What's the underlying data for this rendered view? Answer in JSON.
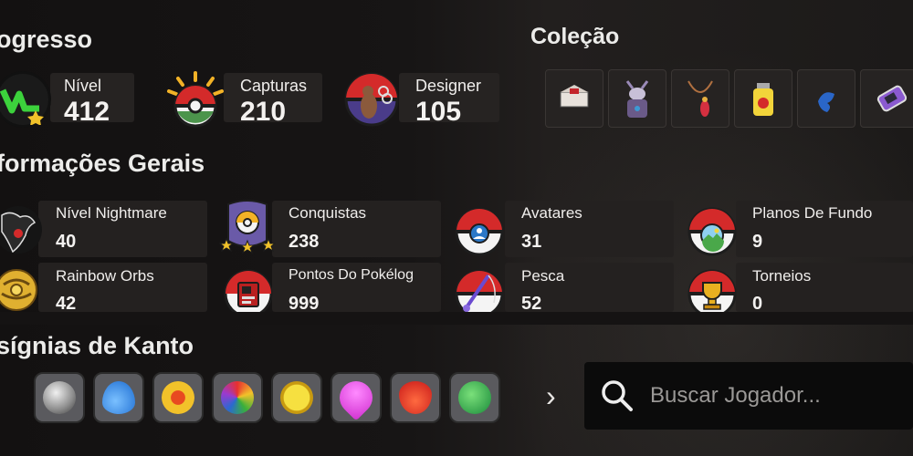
{
  "sections": {
    "progress_title": "ogresso",
    "collection_title": "Coleção",
    "general_title": "formações Gerais",
    "badges_title": "sígnias de Kanto"
  },
  "progress": [
    {
      "label": "Nível",
      "value": "412",
      "icon": "level-icon"
    },
    {
      "label": "Capturas",
      "value": "210",
      "icon": "pokeball-sun-icon"
    },
    {
      "label": "Designer",
      "value": "105",
      "icon": "designer-scissors-icon"
    }
  ],
  "general": [
    {
      "label": "Nível Nightmare",
      "value": "40",
      "icon": "darkrai-icon"
    },
    {
      "label": "Conquistas",
      "value": "238",
      "icon": "stars-pokeball-icon"
    },
    {
      "label": "Avatares",
      "value": "31",
      "icon": "avatar-pokeball-icon"
    },
    {
      "label": "Planos De Fundo",
      "value": "9",
      "icon": "landscape-pokeball-icon"
    },
    {
      "label": "Rainbow Orbs",
      "value": "42",
      "icon": "rainbow-orb-icon"
    },
    {
      "label": "Pontos Do Pokélog",
      "value": "999",
      "icon": "pokelog-icon"
    },
    {
      "label": "Pesca",
      "value": "52",
      "icon": "fishing-rod-icon"
    },
    {
      "label": "Torneios",
      "value": "0",
      "icon": "trophy-icon"
    }
  ],
  "collection_items": [
    "red-box-item-icon",
    "mewtwo-armor-item-icon",
    "pendant-item-icon",
    "potion-jar-item-icon",
    "blue-creature-item-icon",
    "purple-device-item-icon"
  ],
  "badges": [
    "boulder-badge-icon",
    "cascade-badge-icon",
    "thunder-badge-icon",
    "rainbow-badge-icon",
    "soul-badge-icon",
    "marsh-badge-icon",
    "volcano-badge-icon",
    "earth-badge-icon"
  ],
  "nav": {
    "next": "›"
  },
  "search": {
    "placeholder": "Buscar Jogador..."
  },
  "colors": {
    "accent_red": "#d42a2a",
    "panel": "#262322",
    "search_bg": "#0b0b0b"
  }
}
